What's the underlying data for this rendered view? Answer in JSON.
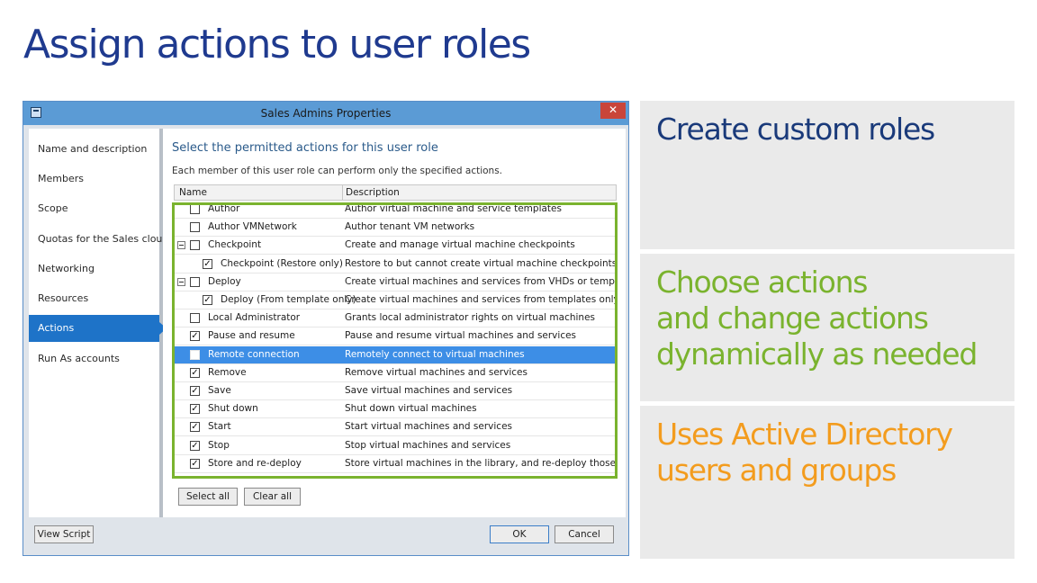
{
  "slide_title": "Assign actions to user roles",
  "dialog": {
    "title": "Sales Admins Properties",
    "close_glyph": "✕",
    "nav_items": [
      {
        "label": "Name and description",
        "active": false
      },
      {
        "label": "Members",
        "active": false
      },
      {
        "label": "Scope",
        "active": false
      },
      {
        "label": "Quotas for the Sales cloud",
        "active": false
      },
      {
        "label": "Networking",
        "active": false
      },
      {
        "label": "Resources",
        "active": false
      },
      {
        "label": "Actions",
        "active": true
      },
      {
        "label": "Run As accounts",
        "active": false
      }
    ],
    "heading": "Select the permitted actions for this user role",
    "subheading": "Each member of this user role can perform only the specified actions.",
    "columns": {
      "name": "Name",
      "description": "Description"
    },
    "rows": [
      {
        "name": "Author",
        "description": "Author virtual machine and service templates",
        "checked": false,
        "level": 0,
        "expander": false,
        "selected": false
      },
      {
        "name": "Author VMNetwork",
        "description": "Author tenant VM networks",
        "checked": false,
        "level": 0,
        "expander": false,
        "selected": false
      },
      {
        "name": "Checkpoint",
        "description": "Create and manage virtual machine checkpoints",
        "checked": false,
        "level": 0,
        "expander": true,
        "selected": false
      },
      {
        "name": "Checkpoint (Restore only)",
        "description": "Restore to but cannot create virtual machine checkpoints",
        "checked": true,
        "level": 1,
        "expander": false,
        "selected": false
      },
      {
        "name": "Deploy",
        "description": "Create virtual machines and services from VHDs or templates",
        "checked": false,
        "level": 0,
        "expander": true,
        "selected": false
      },
      {
        "name": "Deploy (From template only)",
        "description": "Create virtual machines and services from templates only",
        "checked": true,
        "level": 1,
        "expander": false,
        "selected": false
      },
      {
        "name": "Local Administrator",
        "description": "Grants local administrator rights on virtual machines",
        "checked": false,
        "level": 0,
        "expander": false,
        "selected": false
      },
      {
        "name": "Pause and resume",
        "description": "Pause and resume virtual machines and services",
        "checked": true,
        "level": 0,
        "expander": false,
        "selected": false
      },
      {
        "name": "Remote connection",
        "description": "Remotely connect to virtual machines",
        "checked": false,
        "level": 0,
        "expander": false,
        "selected": true
      },
      {
        "name": "Remove",
        "description": "Remove virtual machines and services",
        "checked": true,
        "level": 0,
        "expander": false,
        "selected": false
      },
      {
        "name": "Save",
        "description": "Save virtual machines and services",
        "checked": true,
        "level": 0,
        "expander": false,
        "selected": false
      },
      {
        "name": "Shut down",
        "description": "Shut down virtual machines",
        "checked": true,
        "level": 0,
        "expander": false,
        "selected": false
      },
      {
        "name": "Start",
        "description": "Start virtual machines and services",
        "checked": true,
        "level": 0,
        "expander": false,
        "selected": false
      },
      {
        "name": "Stop",
        "description": "Stop virtual machines and services",
        "checked": true,
        "level": 0,
        "expander": false,
        "selected": false
      },
      {
        "name": "Store and re-deploy",
        "description": "Store virtual machines in the library, and re-deploy those virtu...",
        "checked": true,
        "level": 0,
        "expander": false,
        "selected": false
      }
    ],
    "buttons": {
      "select_all": "Select all",
      "clear_all": "Clear all",
      "view_script": "View Script",
      "ok": "OK",
      "cancel": "Cancel"
    }
  },
  "panels": [
    {
      "text": "Create custom roles",
      "color": "#1a3a7a"
    },
    {
      "text": "Choose actions\nand change actions\ndynamically as needed",
      "color": "#7ab32e"
    },
    {
      "text": "Uses Active Directory\nusers and groups",
      "color": "#f39c1e"
    }
  ],
  "colors": {
    "selection": "#3d8ee6",
    "nav_active": "#1e73c8",
    "highlight_border": "#7ab32e",
    "titlebar": "#5b9bd5"
  }
}
